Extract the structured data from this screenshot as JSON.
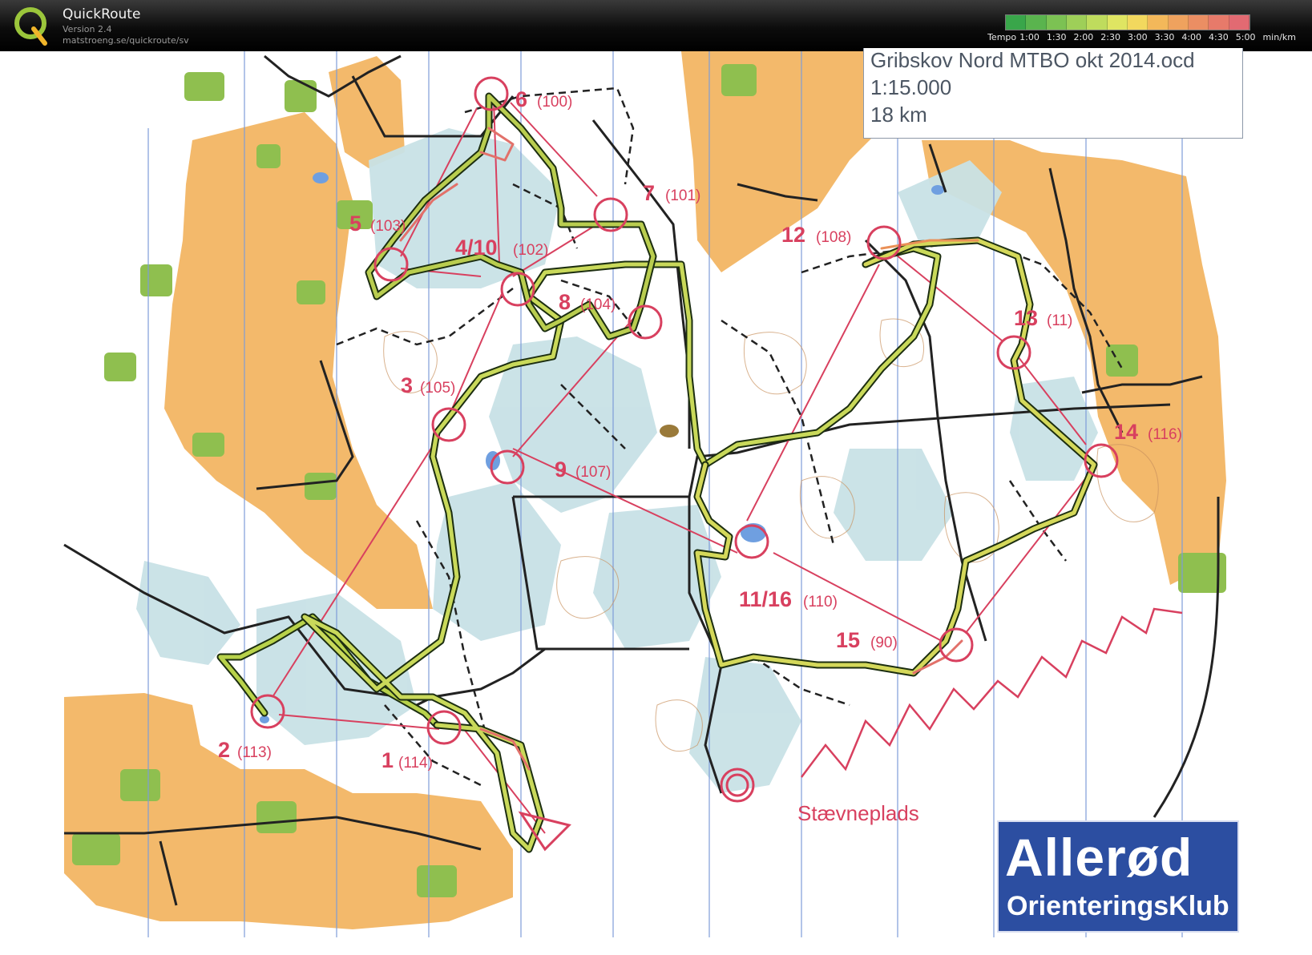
{
  "app": {
    "name": "QuickRoute",
    "version": "Version 2.4",
    "url": "matstroeng.se/quickroute/sv",
    "logo_letter": "Q"
  },
  "tempo_legend": {
    "label": "Tempo",
    "ticks": [
      "1:00",
      "1:30",
      "2:00",
      "2:30",
      "3:00",
      "3:30",
      "4:00",
      "4:30",
      "5:00"
    ],
    "unit": "min/km",
    "colors": [
      "#39a64a",
      "#5ab44e",
      "#7cc253",
      "#9ecf58",
      "#bfdc5d",
      "#dfe562",
      "#f2d85e",
      "#f3b85a",
      "#efa25e",
      "#eb8e63",
      "#e77a6a",
      "#e26a72"
    ]
  },
  "map_info": {
    "filename": "Gribskov Nord MTBO okt 2014.ocd",
    "scale": "1:15.000",
    "distance": "18 km"
  },
  "controls": [
    {
      "label": "1",
      "code": "(114)"
    },
    {
      "label": "2",
      "code": "(113)"
    },
    {
      "label": "3",
      "code": "(105)"
    },
    {
      "label": "4/10",
      "code": "(102)"
    },
    {
      "label": "5",
      "code": "(103)"
    },
    {
      "label": "6",
      "code": "(100)"
    },
    {
      "label": "7",
      "code": "(101)"
    },
    {
      "label": "8",
      "code": "(104)"
    },
    {
      "label": "9",
      "code": "(107)"
    },
    {
      "label": "11/16",
      "code": "(110)"
    },
    {
      "label": "12",
      "code": "(108)"
    },
    {
      "label": "13",
      "code": "(11)"
    },
    {
      "label": "14",
      "code": "(116)"
    },
    {
      "label": "15",
      "code": "(90)"
    }
  ],
  "start_finish_label": "Stævneplads",
  "club_logo": {
    "name": "Allerød",
    "subtitle": "OrienteringsKlub"
  },
  "colors": {
    "course": "#d8405f",
    "open_land": "#f3b96b",
    "forest_green": "#bcd9e0",
    "building_green": "#8fbf4f"
  }
}
